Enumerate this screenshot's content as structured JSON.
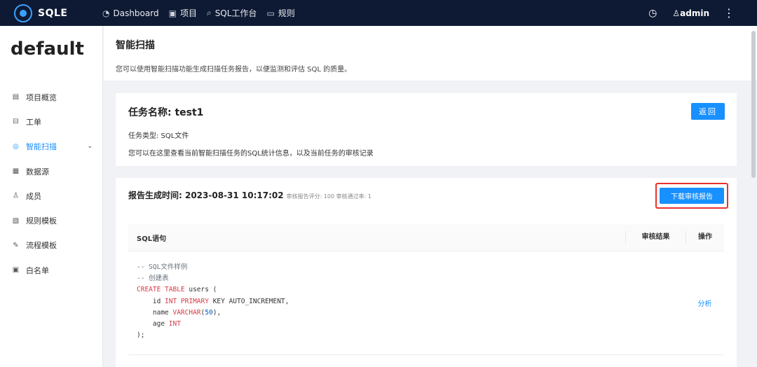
{
  "topbar": {
    "logo_text": "SQLE",
    "nav": [
      {
        "label": "Dashboard",
        "icon": "dashboard-icon",
        "glyph": "◔"
      },
      {
        "label": "项目",
        "icon": "project-icon",
        "glyph": "▣"
      },
      {
        "label": "SQL工作台",
        "icon": "search-icon",
        "glyph": "⌕"
      },
      {
        "label": "规则",
        "icon": "monitor-icon",
        "glyph": "▭"
      }
    ],
    "user": "admin"
  },
  "sidebar": {
    "project_name": "default",
    "items": [
      {
        "label": "项目概览",
        "icon": "overview-icon",
        "glyph": "▤",
        "active": false
      },
      {
        "label": "工单",
        "icon": "ticket-icon",
        "glyph": "⊟",
        "active": false
      },
      {
        "label": "智能扫描",
        "icon": "scan-icon",
        "glyph": "◎",
        "active": true
      },
      {
        "label": "数据源",
        "icon": "datasource-icon",
        "glyph": "▦",
        "active": false
      },
      {
        "label": "成员",
        "icon": "member-icon",
        "glyph": "♙",
        "active": false
      },
      {
        "label": "规则模板",
        "icon": "rule-template-icon",
        "glyph": "▧",
        "active": false
      },
      {
        "label": "流程模板",
        "icon": "flow-template-icon",
        "glyph": "✎",
        "active": false
      },
      {
        "label": "白名单",
        "icon": "whitelist-icon",
        "glyph": "▣",
        "active": false
      }
    ]
  },
  "page": {
    "title": "智能扫描",
    "description": "您可以使用智能扫描功能生成扫描任务报告，以便监测和评估 SQL 的质量。"
  },
  "task": {
    "name": "任务名称: test1",
    "type": "任务类型: SQL文件",
    "description": "您可以在这里查看当前智能扫描任务的SQL统计信息，以及当前任务的审核记录",
    "back_label": "返回"
  },
  "report": {
    "generated_time": "报告生成时间: 2023-08-31 10:17:02",
    "meta": "审核报告评分: 100 审核通过率: 1",
    "download_label": "下载审核报告",
    "columns": {
      "sql": "SQL语句",
      "result": "审核结果",
      "action": "操作"
    },
    "rows": [
      {
        "sql_lines": [
          [
            {
              "t": "-- SQL文件样例",
              "c": "cm"
            }
          ],
          [
            {
              "t": "-- 创建表",
              "c": "cm"
            }
          ],
          [
            {
              "t": "CREATE TABLE",
              "c": "kw"
            },
            {
              "t": " users (",
              "c": ""
            }
          ],
          [
            {
              "t": "    id ",
              "c": ""
            },
            {
              "t": "INT PRIMARY",
              "c": "kw"
            },
            {
              "t": " KEY AUTO_INCREMENT,",
              "c": ""
            }
          ],
          [
            {
              "t": "    name ",
              "c": ""
            },
            {
              "t": "VARCHAR",
              "c": "kw"
            },
            {
              "t": "(",
              "c": ""
            },
            {
              "t": "50",
              "c": "num"
            },
            {
              "t": "),",
              "c": ""
            }
          ],
          [
            {
              "t": "    age ",
              "c": ""
            },
            {
              "t": "INT",
              "c": "kw"
            }
          ],
          [
            {
              "t": ");",
              "c": ""
            }
          ]
        ],
        "result": "",
        "action": "分析"
      }
    ]
  }
}
